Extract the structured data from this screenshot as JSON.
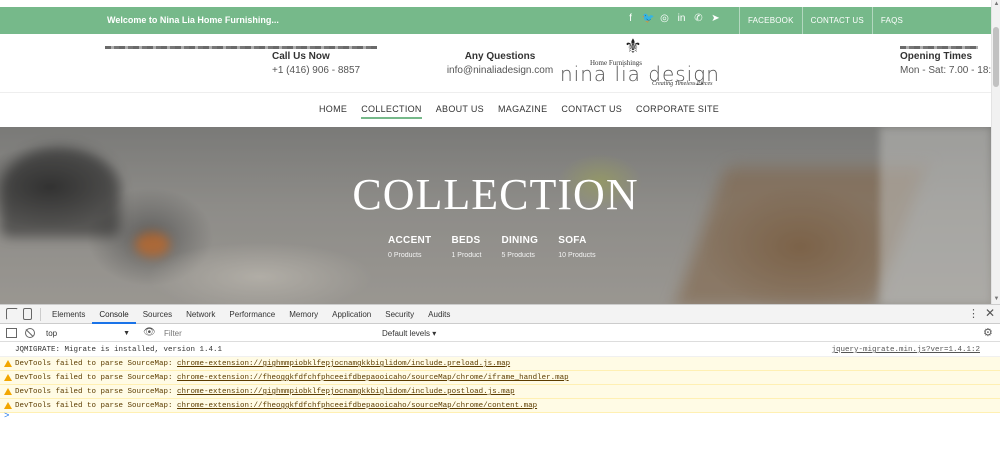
{
  "topbar": {
    "welcome": "Welcome to Nina Lia Home Furnishing...",
    "socials": [
      {
        "icon": "facebook-icon",
        "glyph": "f"
      },
      {
        "icon": "twitter-icon",
        "glyph": "🐦"
      },
      {
        "icon": "instagram-icon",
        "glyph": "◎"
      },
      {
        "icon": "linkedin-icon",
        "glyph": "in"
      },
      {
        "icon": "whatsapp-icon",
        "glyph": "✆"
      },
      {
        "icon": "telegram-icon",
        "glyph": "➤"
      }
    ],
    "links": [
      "FACEBOOK",
      "CONTACT US",
      "FAQS"
    ]
  },
  "header": {
    "call": {
      "label": "Call Us Now",
      "value": "+1 (416) 906 - 8857"
    },
    "questions": {
      "label": "Any Questions",
      "value": "info@ninaliadesign.com"
    },
    "logo": {
      "small": "Home Furnishings",
      "big": "nina lia design",
      "tagline": "Creating Timeless Pieces",
      "emblem": "⚜"
    },
    "hours": {
      "label": "Opening Times",
      "value": "Mon - Sat: 7.00 - 18:0"
    }
  },
  "nav": {
    "items": [
      "HOME",
      "COLLECTION",
      "ABOUT US",
      "MAGAZINE",
      "CONTACT US",
      "CORPORATE SITE"
    ],
    "active": "COLLECTION"
  },
  "hero": {
    "title": "COLLECTION",
    "categories": [
      {
        "name": "ACCENT",
        "count": "0 Products"
      },
      {
        "name": "BEDS",
        "count": "1 Product"
      },
      {
        "name": "DINING",
        "count": "5 Products"
      },
      {
        "name": "SOFA",
        "count": "10 Products"
      }
    ]
  },
  "devtools": {
    "tabs": [
      "Elements",
      "Console",
      "Sources",
      "Network",
      "Performance",
      "Memory",
      "Application",
      "Security",
      "Audits"
    ],
    "active_tab": "Console",
    "context": "top",
    "filter_placeholder": "Filter",
    "levels": "Default levels ▾",
    "messages": [
      {
        "type": "log",
        "text": "JQMIGRATE: Migrate is installed, version 1.4.1",
        "source": "jquery-migrate.min.js?ver=1.4.1:2"
      },
      {
        "type": "warn",
        "text": "DevTools failed to parse SourceMap: ",
        "link": "chrome-extension://gighmmpiobklfepjocnamgkkbiglidom/include.preload.js.map"
      },
      {
        "type": "warn",
        "text": "DevTools failed to parse SourceMap: ",
        "link": "chrome-extension://fheoggkfdfchfphceeifdbepaooicaho/sourceMap/chrome/iframe_handler.map"
      },
      {
        "type": "warn",
        "text": "DevTools failed to parse SourceMap: ",
        "link": "chrome-extension://gighmmpiobklfepjocnamgkkbiglidom/include.postload.js.map"
      },
      {
        "type": "warn",
        "text": "DevTools failed to parse SourceMap: ",
        "link": "chrome-extension://fheoggkfdfchfphceeifdbepaooicaho/sourceMap/chrome/content.map"
      }
    ],
    "prompt": ">"
  },
  "colors": {
    "brand_green": "#76b98a",
    "warning_bg": "#fffbe5",
    "devtools_accent": "#1a73e8"
  }
}
